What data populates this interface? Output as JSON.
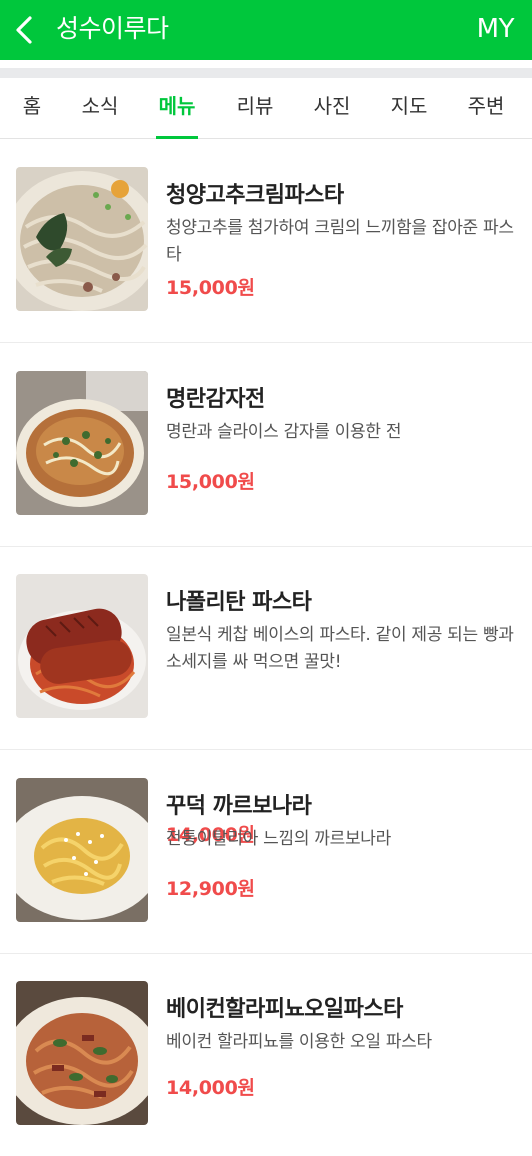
{
  "header": {
    "title": "성수이루다",
    "my_label": "MY",
    "background": "#00c73c"
  },
  "tabs": [
    {
      "label": "홈"
    },
    {
      "label": "소식"
    },
    {
      "label": "메뉴",
      "active": true
    },
    {
      "label": "리뷰"
    },
    {
      "label": "사진"
    },
    {
      "label": "지도"
    },
    {
      "label": "주변"
    }
  ],
  "accent_color": "#00c73c",
  "price_color": "#f04b4b",
  "menu": [
    {
      "name": "청양고추크림파스타",
      "desc": "청양고추를 첨가하여 크림의 느끼함을 잡아준 파스타",
      "price": "15,000원",
      "photo": "cream-pasta-photo"
    },
    {
      "name": "명란감자전",
      "desc": "명란과 슬라이스 감자를 이용한 전",
      "price": "15,000원",
      "photo": "potato-pancake-photo"
    },
    {
      "name": "나폴리탄 파스타",
      "desc": "일본식 케찹 베이스의 파스타. 같이 제공 되는 빵과 소세지를 싸 먹으면 꿀맛!",
      "price": "14,000원",
      "photo": "napolitan-pasta-photo"
    },
    {
      "name": "꾸덕 까르보나라",
      "desc": "전통이탈리아 느낌의 까르보나라",
      "price": "12,900원",
      "photo": "carbonara-photo"
    },
    {
      "name": "베이컨할라피뇨오일파스타",
      "desc": "베이컨 할라피뇨를 이용한 오일 파스타",
      "price": "14,000원",
      "photo": "jalapeno-oil-pasta-photo"
    }
  ]
}
